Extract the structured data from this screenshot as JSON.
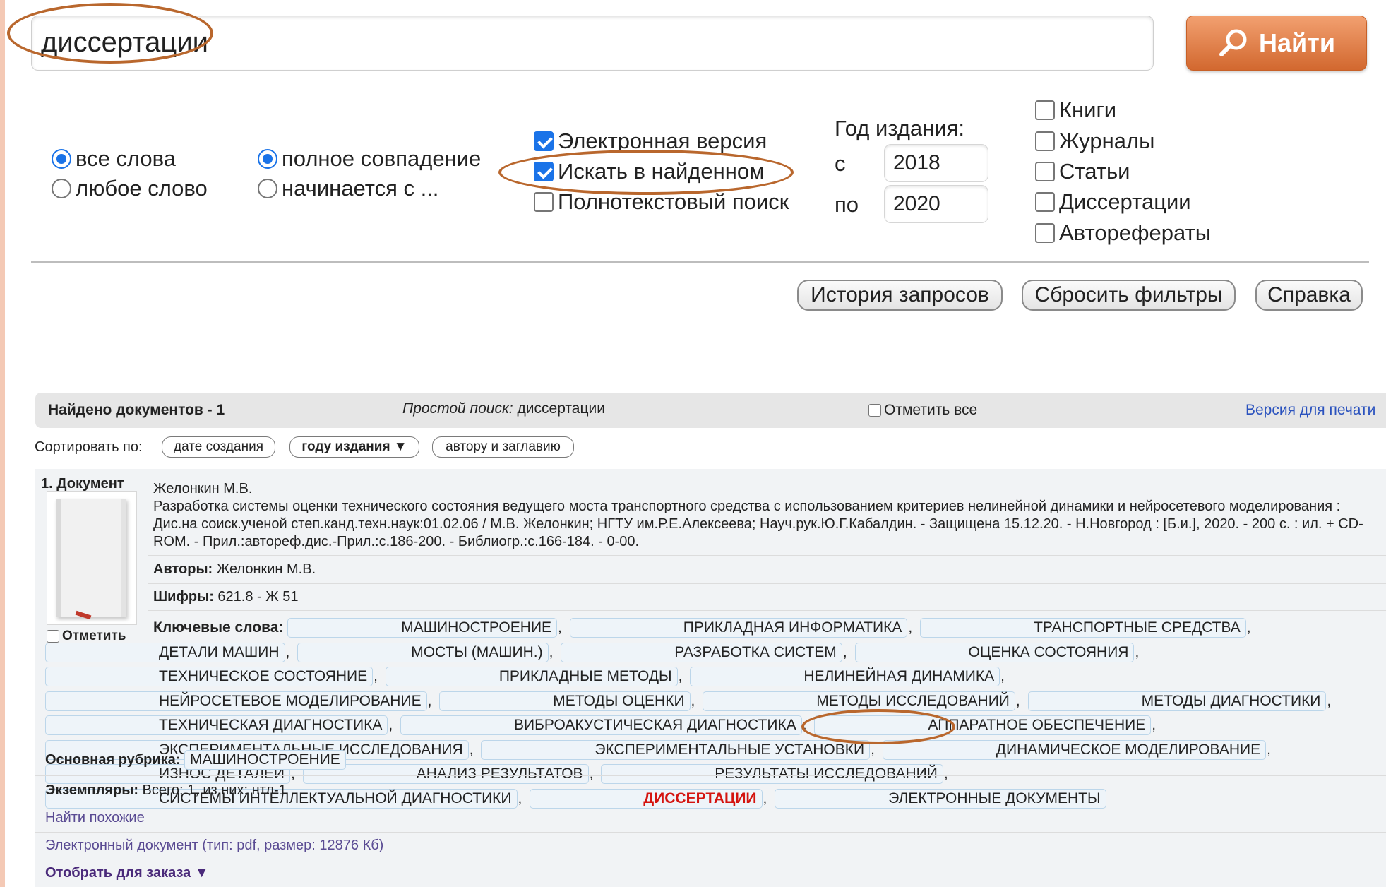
{
  "search": {
    "query": "диссертации",
    "submit_label": "Найти"
  },
  "word_mode": {
    "all_words": "все слова",
    "any_word": "любое слово",
    "selected": "all_words"
  },
  "match_mode": {
    "full": "полное совпадение",
    "starts": "начинается с ...",
    "selected": "full"
  },
  "options": {
    "electronic": "Электронная версия",
    "electronic_checked": true,
    "in_found": "Искать в найденном",
    "in_found_checked": true,
    "fulltext": "Полнотекстовый поиск",
    "fulltext_checked": false
  },
  "year": {
    "label": "Год издания:",
    "from_label": "с",
    "from_value": "2018",
    "to_label": "по",
    "to_value": "2020"
  },
  "doc_types": [
    "Книги",
    "Журналы",
    "Статьи",
    "Диссертации",
    "Авторефераты"
  ],
  "actions": {
    "history": "История запросов",
    "reset": "Сбросить фильтры",
    "help": "Справка"
  },
  "results": {
    "found": "Найдено документов - 1",
    "query_prefix": "Простой поиск:",
    "query_text": "диссертации",
    "mark_all": "Отметить все",
    "print_version": "Версия для печати"
  },
  "sort": {
    "label": "Сортировать по:",
    "by_date": "дате создания",
    "by_year": "году издания ▼",
    "by_author": "автору и заглавию"
  },
  "record": {
    "number_label": "1. Документ",
    "mark_label": "Отметить",
    "author_line": "Желонкин М.В.",
    "description": "Разработка системы оценки технического состояния ведущего моста транспортного средства с использованием критериев нелинейной динамики и нейросетевого моделирования : Дис.на соиск.ученой степ.канд.техн.наук:01.02.06 / М.В. Желонкин; НГТУ им.Р.Е.Алексеева; Науч.рук.Ю.Г.Кабалдин. - Защищена 15.12.20. - Н.Новгород : [Б.и.], 2020. - 200 с. : ил. + CD-ROM. - Прил.:автореф.дис.-Прил.:с.186-200. - Библиогр.:с.166-184. - 0-00.",
    "authors_label": "Авторы:",
    "authors_value": "Желонкин М.В.",
    "codes_label": "Шифры:",
    "codes_value": "621.8 - Ж 51",
    "keywords_label": "Ключевые слова:",
    "keywords": [
      "МАШИНОСТРОЕНИЕ",
      "ПРИКЛАДНАЯ ИНФОРМАТИКА",
      "ТРАНСПОРТНЫЕ СРЕДСТВА",
      "ДЕТАЛИ МАШИН",
      "МОСТЫ (МАШИН.)",
      "РАЗРАБОТКА СИСТЕМ",
      "ОЦЕНКА СОСТОЯНИЯ",
      "ТЕХНИЧЕСКОЕ СОСТОЯНИЕ",
      "ПРИКЛАДНЫЕ МЕТОДЫ",
      "НЕЛИНЕЙНАЯ ДИНАМИКА",
      "НЕЙРОСЕТЕВОЕ МОДЕЛИРОВАНИЕ",
      "МЕТОДЫ ОЦЕНКИ",
      "МЕТОДЫ ИССЛЕДОВАНИЙ",
      "МЕТОДЫ ДИАГНОСТИКИ",
      "ТЕХНИЧЕСКАЯ ДИАГНОСТИКА",
      "ВИБРОАКУСТИЧЕСКАЯ ДИАГНОСТИКА",
      "АППАРАТНОЕ ОБЕСПЕЧЕНИЕ",
      "ЭКСПЕРИМЕНТАЛЬНЫЕ ИССЛЕДОВАНИЯ",
      "ЭКСПЕРИМЕНТАЛЬНЫЕ УСТАНОВКИ",
      "ДИНАМИЧЕСКОЕ МОДЕЛИРОВАНИЕ",
      "ИЗНОС ДЕТАЛЕЙ",
      "АНАЛИЗ РЕЗУЛЬТАТОВ",
      "РЕЗУЛЬТАТЫ ИССЛЕДОВАНИЙ",
      "СИСТЕМЫ ИНТЕЛЛЕКТУАЛЬНОЙ ДИАГНОСТИКИ",
      "ДИССЕРТАЦИИ",
      "ЭЛЕКТРОННЫЕ ДОКУМЕНТЫ"
    ],
    "highlighted_keyword": "ДИССЕРТАЦИИ",
    "rubric_label": "Основная рубрика:",
    "rubric_value": "МАШИНОСТРОЕНИЕ",
    "copies_label": "Экземпляры:",
    "copies_value": "Всего: 1, из них: нтл-1",
    "find_similar": "Найти похожие",
    "e_document": "Электронный документ (тип: pdf, размер: 12876 Кб)",
    "order": "Отобрать для заказа ▼"
  },
  "colors": {
    "accent_orange": "#d2682f",
    "annotation_oval": "#b9672d",
    "highlight_red": "#d4140f",
    "link": "#5a4b93"
  }
}
